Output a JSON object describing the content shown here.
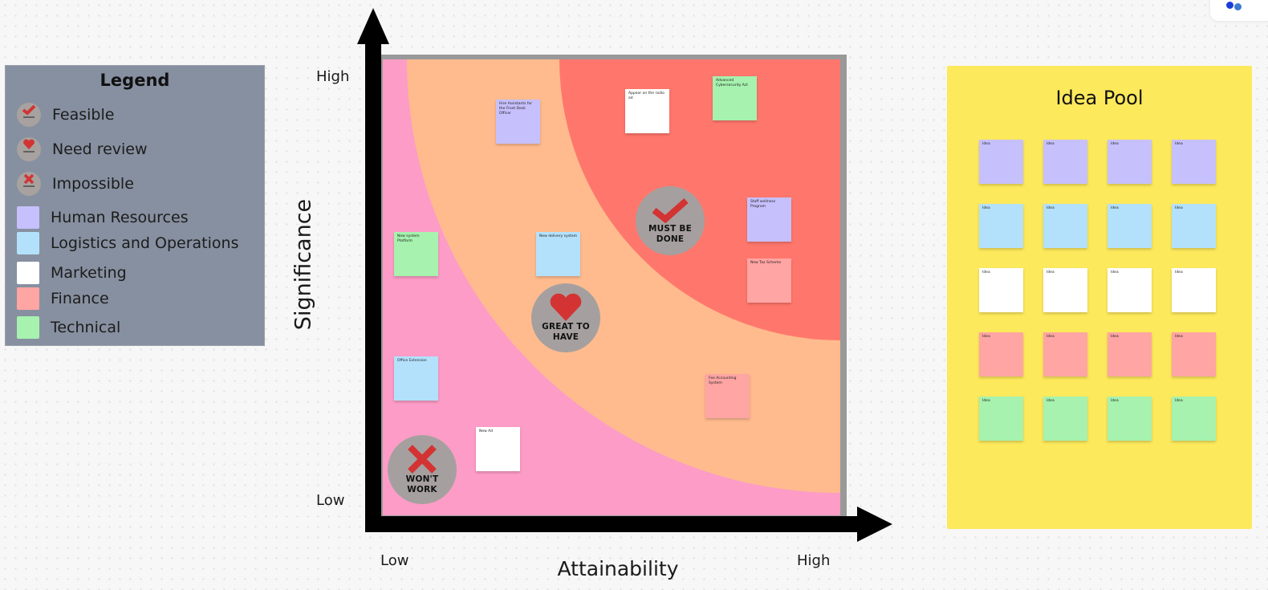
{
  "legend": {
    "title": "Legend",
    "items": [
      {
        "icon": "check-badge",
        "label": "Feasible"
      },
      {
        "icon": "heart-badge",
        "label": "Need review"
      },
      {
        "icon": "x-badge",
        "label": "Impossible"
      },
      {
        "color": "#c6c0fd",
        "label": "Human Resources"
      },
      {
        "color": "#b3e1fc",
        "label": "Logistics and Operations"
      },
      {
        "color": "#ffffff",
        "label": "Marketing"
      },
      {
        "color": "#ffa5a3",
        "label": "Finance"
      },
      {
        "color": "#a6f2ae",
        "label": "Technical"
      }
    ]
  },
  "axes": {
    "y_title": "Significance",
    "y_high": "High",
    "y_low": "Low",
    "x_title": "Attainability",
    "x_low": "Low",
    "x_high": "High"
  },
  "zones": {
    "must": {
      "line1": "MUST BE",
      "line2": "DONE",
      "color": "#ff776c"
    },
    "great": {
      "line1": "GREAT TO",
      "line2": "HAVE",
      "color": "#ffbb8e"
    },
    "wont": {
      "line1": "WON'T",
      "line2": "WORK",
      "color": "#fd9cc6"
    }
  },
  "matrix_stickies": [
    {
      "category": "Human Resources",
      "text": "Hire Assistants for the Front Desk Officer"
    },
    {
      "category": "Marketing",
      "text": "Appear on the radio ad"
    },
    {
      "category": "Technical",
      "text": "Advanced Cybersecurity Act"
    },
    {
      "category": "Human Resources",
      "text": "Staff wellness Program"
    },
    {
      "category": "Finance",
      "text": "New Tax Scheme"
    },
    {
      "category": "Technical",
      "text": "New system Platform"
    },
    {
      "category": "Logistics and Operations",
      "text": "New delivery system"
    },
    {
      "category": "Logistics and Operations",
      "text": "Office Extension"
    },
    {
      "category": "Marketing",
      "text": "New Ad"
    },
    {
      "category": "Finance",
      "text": "Fee Accounting System"
    }
  ],
  "idea_pool": {
    "title": "Idea Pool",
    "rows": [
      {
        "category": "Human Resources",
        "items": [
          "Idea",
          "Idea",
          "Idea",
          "Idea"
        ]
      },
      {
        "category": "Logistics and Operations",
        "items": [
          "Idea",
          "Idea",
          "Idea",
          "Idea"
        ]
      },
      {
        "category": "Marketing",
        "items": [
          "Idea",
          "Idea",
          "Idea",
          "Idea"
        ]
      },
      {
        "category": "Finance",
        "items": [
          "Idea",
          "Idea",
          "Idea",
          "Idea"
        ]
      },
      {
        "category": "Technical",
        "items": [
          "Idea",
          "Idea",
          "Idea",
          "Idea"
        ]
      }
    ]
  }
}
